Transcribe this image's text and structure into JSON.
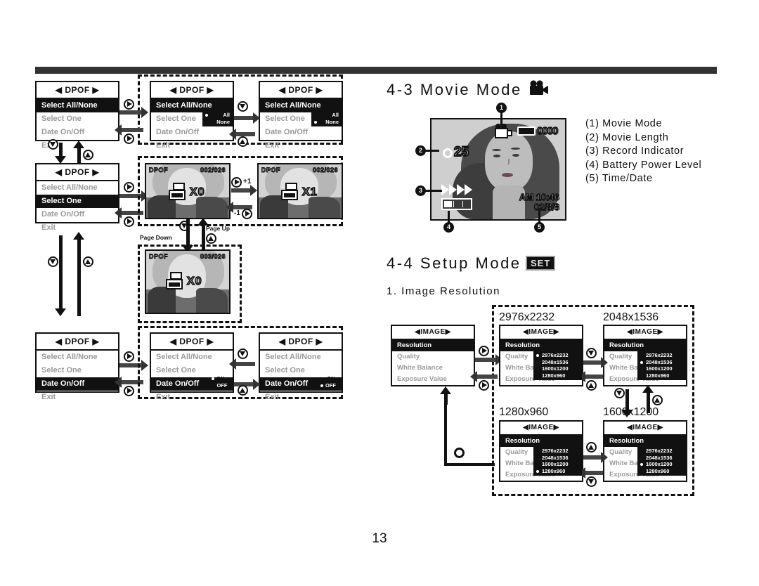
{
  "page": {
    "number": "13"
  },
  "dpof_flow": {
    "menu_title": "◀ DPOF ▶",
    "items": [
      "Select All/None",
      "Select One",
      "Date On/Off",
      "Exit"
    ],
    "screens": [
      {
        "id": "dpof-select-all-none",
        "selected": "Select All/None",
        "popup": null
      },
      {
        "id": "dpof-all-chosen",
        "selected": "Select All/None",
        "popup": {
          "options": [
            "All",
            "None"
          ],
          "checked": "All"
        }
      },
      {
        "id": "dpof-none-chosen",
        "selected": "Select All/None",
        "popup": {
          "options": [
            "All",
            "None"
          ],
          "checked": "None"
        }
      },
      {
        "id": "dpof-select-one",
        "selected": "Select One",
        "popup": null
      },
      {
        "id": "dpof-date-onoff",
        "selected": "Date On/Off",
        "popup": null
      },
      {
        "id": "dpof-date-on",
        "selected": "Date On/Off",
        "popup": {
          "options": [
            "ON",
            "OFF"
          ],
          "checked": "ON"
        }
      },
      {
        "id": "dpof-date-off",
        "selected": "Date On/Off",
        "popup": {
          "options": [
            "ON",
            "OFF"
          ],
          "checked": "OFF"
        }
      }
    ],
    "thumbnails": [
      {
        "id": "thumb-002-x0",
        "tag": "DPOF",
        "count": "002/026",
        "copies": "X0"
      },
      {
        "id": "thumb-002-x1",
        "tag": "DPOF",
        "count": "002/026",
        "copies": "X1"
      },
      {
        "id": "thumb-003-x0",
        "tag": "DPOF",
        "count": "003/026",
        "copies": "X0"
      }
    ],
    "labels": {
      "page_down": "Page Down",
      "page_up": "Page Up",
      "plus_one": "+1",
      "minus_one": "-1"
    }
  },
  "movie_mode": {
    "heading": "4-3 Movie Mode",
    "heading_icon": "movie-camera-icon",
    "lcd": {
      "counter": "0000",
      "movie_length": "25",
      "time": "AM 10:46",
      "date": "02/8/8"
    },
    "legend": [
      "(1) Movie Mode",
      "(2) Movie Length",
      "(3) Record Indicator",
      "(4) Battery Power Level",
      "(5) Time/Date"
    ],
    "callouts": [
      "1",
      "2",
      "3",
      "4",
      "5"
    ]
  },
  "setup_mode": {
    "heading": "4-4 Setup Mode",
    "heading_badge": "SET",
    "subheading": "1. Image Resolution",
    "menu_title": "◀IMAGE▶",
    "items": [
      "Resolution",
      "Quality",
      "White Balance",
      "Exposure Value"
    ],
    "items_clipped": [
      "Resolution",
      "Quality",
      "White Ba",
      "Exposure Value"
    ],
    "resolution_options": [
      "2976x2232",
      "2048x1536",
      "1600x1200",
      "1280x960"
    ],
    "screens": [
      {
        "id": "image-menu-base",
        "selected": "Resolution",
        "popup": null,
        "caption": ""
      },
      {
        "id": "image-res-2976",
        "selected": "Resolution",
        "checked": "2976x2232",
        "caption": "2976x2232"
      },
      {
        "id": "image-res-2048",
        "selected": "Resolution",
        "checked": "2048x1536",
        "caption": "2048x1536"
      },
      {
        "id": "image-res-1280",
        "selected": "Resolution",
        "checked": "1280x960",
        "caption": "1280x960"
      },
      {
        "id": "image-res-1600",
        "selected": "Resolution",
        "checked": "1600x1200",
        "caption": "1600x1200"
      }
    ]
  }
}
